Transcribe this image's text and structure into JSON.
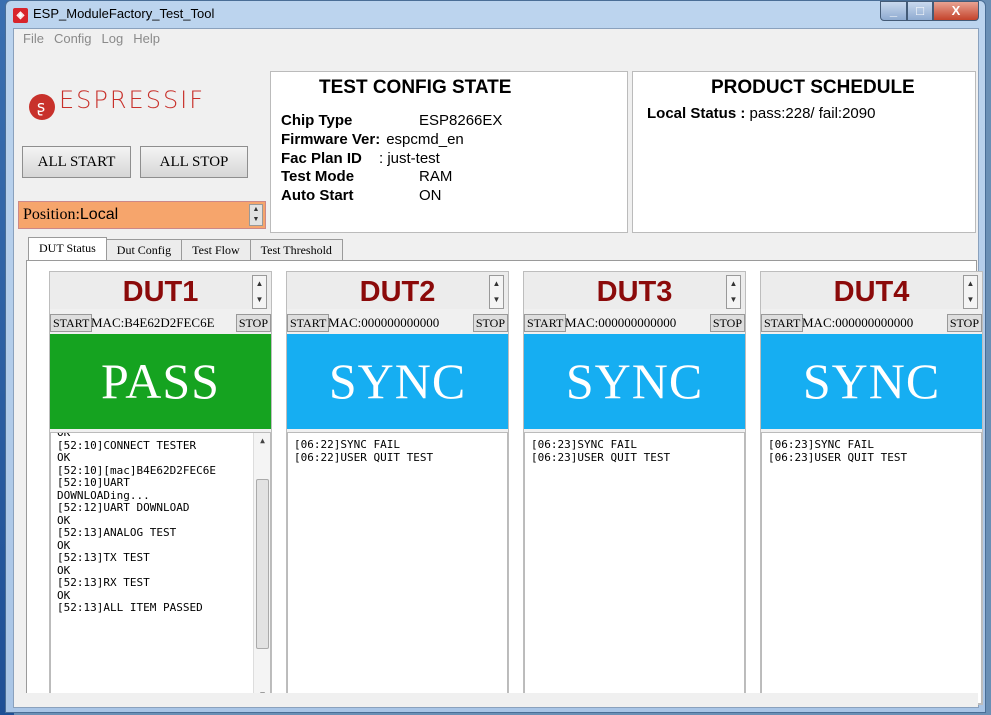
{
  "window": {
    "title": "ESP_ModuleFactory_Test_Tool",
    "min": "_",
    "max": "□",
    "close": "X"
  },
  "menu": [
    "File",
    "Config",
    "Log",
    "Help"
  ],
  "brand": {
    "logo_text": "ESPRESSIF"
  },
  "controls": {
    "all_start": "ALL START",
    "all_stop": "ALL STOP",
    "position_label": "Position:",
    "position_value": "Local"
  },
  "test_config": {
    "title": "TEST CONFIG STATE",
    "rows": [
      {
        "key": "Chip Type",
        "value": "ESP8266EX"
      },
      {
        "key": "Firmware Ver:",
        "value": "espcmd_en"
      },
      {
        "key": "Fac Plan ID",
        "value": ": just-test"
      },
      {
        "key": "Test Mode",
        "value": "RAM"
      },
      {
        "key": "Auto Start",
        "value": "ON"
      }
    ]
  },
  "schedule": {
    "title": "PRODUCT SCHEDULE",
    "label": "Local Status :",
    "value": "pass:228/ fail:2090"
  },
  "tabs": [
    "DUT Status",
    "Dut Config",
    "Test Flow",
    "Test Threshold"
  ],
  "colors": {
    "pass": "#15a320",
    "sync": "#16aef2"
  },
  "duts": [
    {
      "name": "DUT1",
      "start": "START",
      "mac": "MAC:B4E62D2FEC6E",
      "stop": "STOP",
      "status": "PASS",
      "status_color": "#15a320",
      "log": [
        "OK",
        "[52:10]CONNECT TESTER",
        "OK",
        "[52:10][mac]B4E62D2FEC6E",
        "[52:10]UART",
        "DOWNLOADing...",
        "[52:12]UART DOWNLOAD",
        "OK",
        "[52:13]ANALOG TEST",
        "OK",
        "[52:13]TX TEST",
        "OK",
        "[52:13]RX TEST",
        "OK",
        "[52:13]ALL ITEM PASSED"
      ]
    },
    {
      "name": "DUT2",
      "start": "START",
      "mac": "MAC:000000000000",
      "stop": "STOP",
      "status": "SYNC",
      "status_color": "#16aef2",
      "log": [
        "[06:22]SYNC FAIL",
        "[06:22]USER QUIT TEST"
      ]
    },
    {
      "name": "DUT3",
      "start": "START",
      "mac": "MAC:000000000000",
      "stop": "STOP",
      "status": "SYNC",
      "status_color": "#16aef2",
      "log": [
        "[06:23]SYNC FAIL",
        "[06:23]USER QUIT TEST"
      ]
    },
    {
      "name": "DUT4",
      "start": "START",
      "mac": "MAC:000000000000",
      "stop": "STOP",
      "status": "SYNC",
      "status_color": "#16aef2",
      "log": [
        "[06:23]SYNC FAIL",
        "[06:23]USER QUIT TEST"
      ]
    }
  ]
}
